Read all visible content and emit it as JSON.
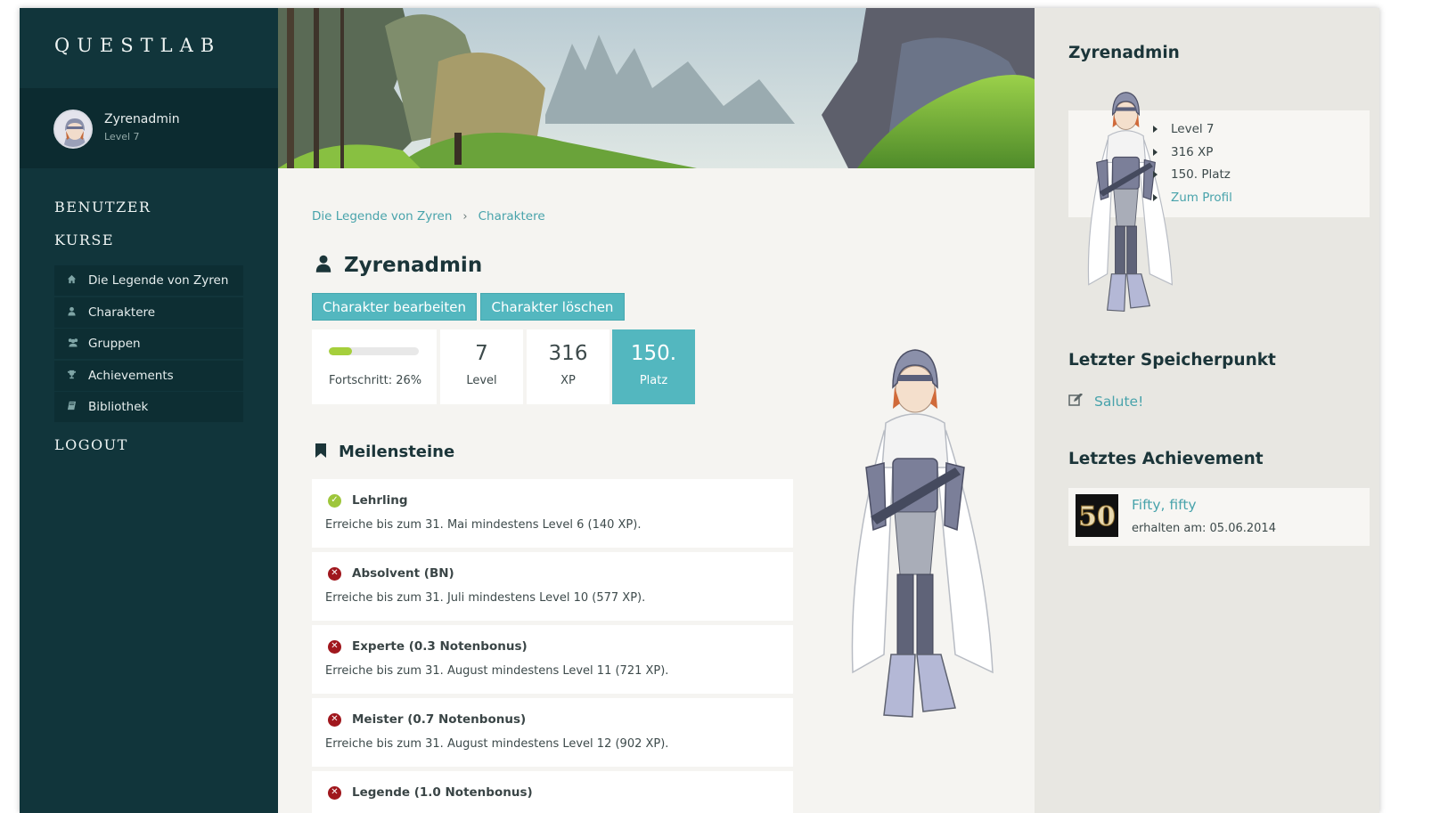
{
  "app": {
    "brand": "QUESTLAB"
  },
  "user": {
    "name": "Zyrenadmin",
    "level": "Level 7"
  },
  "nav": {
    "benutzer": "BENUTZER",
    "kurse": "KURSE",
    "logout": "LOGOUT",
    "course_items": [
      {
        "label": "Die Legende von Zyren",
        "icon": "home-icon"
      },
      {
        "label": "Charaktere",
        "icon": "user-icon"
      },
      {
        "label": "Gruppen",
        "icon": "users-icon"
      },
      {
        "label": "Achievements",
        "icon": "trophy-icon"
      },
      {
        "label": "Bibliothek",
        "icon": "book-icon"
      }
    ]
  },
  "breadcrumb": [
    "Die Legende von Zyren",
    "Charaktere"
  ],
  "character": {
    "name": "Zyrenadmin",
    "edit_label": "Charakter bearbeiten",
    "delete_label": "Charakter löschen",
    "progress_percent": 26,
    "progress_label": "Fortschritt: 26%",
    "level_value": "7",
    "level_label": "Level",
    "xp_value": "316",
    "xp_label": "XP",
    "rank_value": "150.",
    "rank_label": "Platz"
  },
  "milestones": {
    "title": "Meilensteine",
    "items": [
      {
        "name": "Lehrling",
        "desc": "Erreiche bis zum 31. Mai mindestens Level 6 (140 XP).",
        "status": "done"
      },
      {
        "name": "Absolvent (BN)",
        "desc": "Erreiche bis zum 31. Juli mindestens Level 10 (577 XP).",
        "status": "open"
      },
      {
        "name": "Experte (0.3 Notenbonus)",
        "desc": "Erreiche bis zum 31. August mindestens Level 11 (721 XP).",
        "status": "open"
      },
      {
        "name": "Meister (0.7 Notenbonus)",
        "desc": "Erreiche bis zum 31. August mindestens Level 12 (902 XP).",
        "status": "open"
      },
      {
        "name": "Legende (1.0 Notenbonus)",
        "desc": "",
        "status": "open"
      }
    ]
  },
  "right_panel": {
    "name": "Zyrenadmin",
    "items": [
      "Level 7",
      "316 XP",
      "150. Platz"
    ],
    "profile_link": "Zum Profil",
    "savepoint_title": "Letzter Speicherpunkt",
    "savepoint_link": "Salute!",
    "achievement_title": "Letztes Achievement",
    "achievement_name": "Fifty, fifty",
    "achievement_date": "erhalten am: 05.06.2014",
    "achievement_badge": "50"
  },
  "colors": {
    "sidebar": "#11353b",
    "accent": "#53b7bf",
    "success": "#9ec63b",
    "fail": "#a0171d"
  }
}
